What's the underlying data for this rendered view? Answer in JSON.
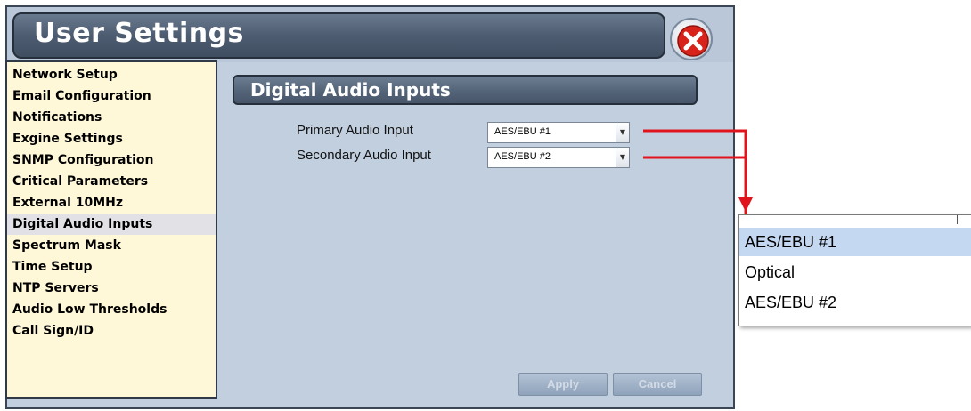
{
  "window": {
    "title": "User Settings"
  },
  "sidebar": {
    "items": [
      {
        "label": "Network Setup"
      },
      {
        "label": "Email Configuration"
      },
      {
        "label": "Notifications"
      },
      {
        "label": "Exgine Settings"
      },
      {
        "label": "SNMP Configuration"
      },
      {
        "label": "Critical Parameters"
      },
      {
        "label": "External 10MHz"
      },
      {
        "label": "Digital Audio Inputs",
        "active": true
      },
      {
        "label": "Spectrum Mask"
      },
      {
        "label": "Time Setup"
      },
      {
        "label": "NTP Servers"
      },
      {
        "label": "Audio Low Thresholds"
      },
      {
        "label": "Call Sign/ID"
      }
    ]
  },
  "main": {
    "section_title": "Digital Audio Inputs",
    "primary": {
      "label": "Primary Audio Input",
      "value": "AES/EBU #1"
    },
    "secondary": {
      "label": "Secondary Audio Input",
      "value": "AES/EBU #2"
    },
    "apply_label": "Apply",
    "cancel_label": "Cancel"
  },
  "dropdown": {
    "options": [
      "AES/EBU #1",
      "Optical",
      "AES/EBU #2"
    ],
    "selected_index": 0
  },
  "icons": {
    "close": "close-x-icon",
    "select_arrow": "chevron-down-icon"
  },
  "colors": {
    "panel_bg": "#c2cfdf",
    "sidebar_bg": "#fff8d8",
    "header_bg": "#4d5c70",
    "close_red": "#d8231b",
    "annotation_red": "#e0141c",
    "selected_option": "#c4d8f2"
  }
}
